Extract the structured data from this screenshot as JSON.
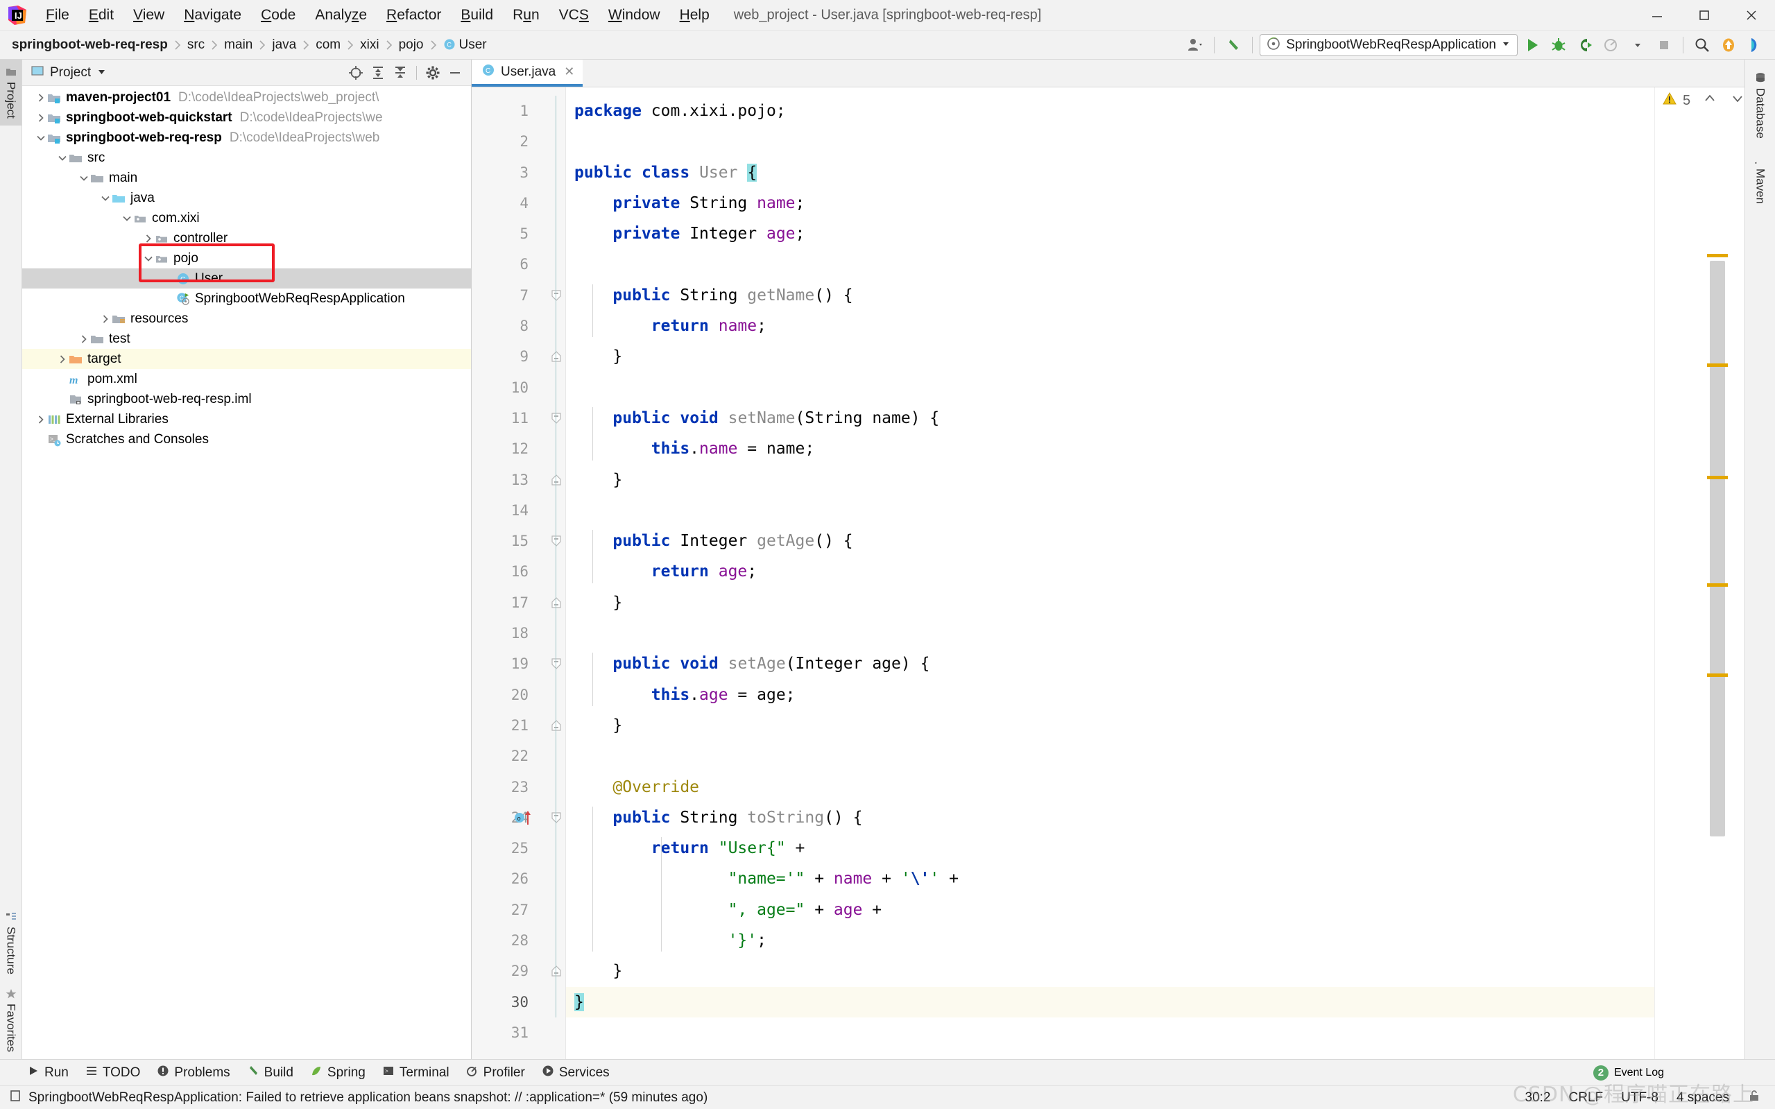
{
  "window": {
    "title": "web_project - User.java [springboot-web-req-resp]",
    "minimize_label": "minimize-window",
    "maximize_label": "maximize-window",
    "close_label": "close-window"
  },
  "menubar": [
    {
      "label": "File",
      "mnemonic": "F"
    },
    {
      "label": "Edit",
      "mnemonic": "E"
    },
    {
      "label": "View",
      "mnemonic": "V"
    },
    {
      "label": "Navigate",
      "mnemonic": "N"
    },
    {
      "label": "Code",
      "mnemonic": "C"
    },
    {
      "label": "Analyze",
      "mnemonic": "z"
    },
    {
      "label": "Refactor",
      "mnemonic": "R"
    },
    {
      "label": "Build",
      "mnemonic": "B"
    },
    {
      "label": "Run",
      "mnemonic": "u"
    },
    {
      "label": "VCS",
      "mnemonic": "S"
    },
    {
      "label": "Window",
      "mnemonic": "W"
    },
    {
      "label": "Help",
      "mnemonic": "H"
    }
  ],
  "breadcrumb": [
    {
      "label": "springboot-web-req-resp",
      "bold": true,
      "icon": ""
    },
    {
      "label": "src",
      "bold": false,
      "icon": ""
    },
    {
      "label": "main",
      "bold": false,
      "icon": ""
    },
    {
      "label": "java",
      "bold": false,
      "icon": ""
    },
    {
      "label": "com",
      "bold": false,
      "icon": ""
    },
    {
      "label": "xixi",
      "bold": false,
      "icon": ""
    },
    {
      "label": "pojo",
      "bold": false,
      "icon": ""
    },
    {
      "label": "User",
      "bold": false,
      "icon": "class-icon"
    }
  ],
  "toolbar": {
    "user_icon": "user-settings-icon",
    "back_icon": "back-arrow-icon",
    "run_config": "SpringbootWebReqRespApplication",
    "run_config_icon": "spring-boot-icon",
    "dropdown_icon": "chevron-down-icon",
    "buttons": [
      {
        "name": "run-button",
        "icon": "play-icon"
      },
      {
        "name": "debug-button",
        "icon": "bug-icon"
      },
      {
        "name": "run-with-coverage-button",
        "icon": "coverage-icon"
      },
      {
        "name": "profile-button",
        "icon": "profiler-icon"
      },
      {
        "name": "stop-button",
        "icon": "stop-icon"
      },
      {
        "name": "search-everywhere-button",
        "icon": "search-icon"
      },
      {
        "name": "update-project-button",
        "icon": "update-icon"
      },
      {
        "name": "ide-assistant-button",
        "icon": "assistant-icon"
      }
    ]
  },
  "left_rail": [
    {
      "label": "Project",
      "icon": "project-icon",
      "active": true
    },
    {
      "label": "Structure",
      "icon": "structure-icon",
      "active": false
    },
    {
      "label": "Favorites",
      "icon": "star-icon",
      "active": false
    }
  ],
  "right_rail": [
    {
      "label": "Database",
      "icon": "database-icon"
    },
    {
      "label": "Maven",
      "icon": "maven-icon"
    }
  ],
  "project_panel": {
    "title": "Project",
    "view_chevron": "chevron-down-icon",
    "tools": [
      {
        "name": "select-opened-file-button",
        "icon": "target-icon"
      },
      {
        "name": "expand-all-button",
        "icon": "expand-all-icon"
      },
      {
        "name": "collapse-all-button",
        "icon": "collapse-all-icon"
      },
      {
        "name": "settings-button",
        "icon": "gear-icon"
      },
      {
        "name": "hide-button",
        "icon": "minus-icon"
      }
    ],
    "tree": [
      {
        "label": "maven-project01",
        "path": "D:\\code\\IdeaProjects\\web_project\\",
        "depth": 0,
        "arrow": "right",
        "icon": "module-icon",
        "bold": true,
        "selected": false,
        "highlight": false
      },
      {
        "label": "springboot-web-quickstart",
        "path": "D:\\code\\IdeaProjects\\we",
        "depth": 0,
        "arrow": "right",
        "icon": "module-icon",
        "bold": true,
        "selected": false,
        "highlight": false
      },
      {
        "label": "springboot-web-req-resp",
        "path": "D:\\code\\IdeaProjects\\web",
        "depth": 0,
        "arrow": "down",
        "icon": "module-icon",
        "bold": true,
        "selected": false,
        "highlight": false
      },
      {
        "label": "src",
        "path": "",
        "depth": 1,
        "arrow": "down",
        "icon": "folder-icon",
        "bold": false,
        "selected": false,
        "highlight": false
      },
      {
        "label": "main",
        "path": "",
        "depth": 2,
        "arrow": "down",
        "icon": "folder-icon",
        "bold": false,
        "selected": false,
        "highlight": false
      },
      {
        "label": "java",
        "path": "",
        "depth": 3,
        "arrow": "down",
        "icon": "source-folder-icon",
        "bold": false,
        "selected": false,
        "highlight": false
      },
      {
        "label": "com.xixi",
        "path": "",
        "depth": 4,
        "arrow": "down",
        "icon": "package-icon",
        "bold": false,
        "selected": false,
        "highlight": false
      },
      {
        "label": "controller",
        "path": "",
        "depth": 5,
        "arrow": "right",
        "icon": "package-icon",
        "bold": false,
        "selected": false,
        "highlight": false
      },
      {
        "label": "pojo",
        "path": "",
        "depth": 5,
        "arrow": "down",
        "icon": "package-icon",
        "bold": false,
        "selected": false,
        "highlight": false
      },
      {
        "label": "User",
        "path": "",
        "depth": 6,
        "arrow": "none",
        "icon": "class-icon",
        "bold": false,
        "selected": true,
        "highlight": false
      },
      {
        "label": "SpringbootWebReqRespApplication",
        "path": "",
        "depth": 6,
        "arrow": "none",
        "icon": "spring-class-icon",
        "bold": false,
        "selected": false,
        "highlight": false
      },
      {
        "label": "resources",
        "path": "",
        "depth": 3,
        "arrow": "right",
        "icon": "resources-folder-icon",
        "bold": false,
        "selected": false,
        "highlight": false
      },
      {
        "label": "test",
        "path": "",
        "depth": 2,
        "arrow": "right",
        "icon": "folder-icon",
        "bold": false,
        "selected": false,
        "highlight": false
      },
      {
        "label": "target",
        "path": "",
        "depth": 1,
        "arrow": "right",
        "icon": "excluded-folder-icon",
        "bold": false,
        "selected": false,
        "highlight": true
      },
      {
        "label": "pom.xml",
        "path": "",
        "depth": 1,
        "arrow": "none",
        "icon": "maven-file-icon",
        "bold": false,
        "selected": false,
        "highlight": false
      },
      {
        "label": "springboot-web-req-resp.iml",
        "path": "",
        "depth": 1,
        "arrow": "none",
        "icon": "iml-file-icon",
        "bold": false,
        "selected": false,
        "highlight": false
      },
      {
        "label": "External Libraries",
        "path": "",
        "depth": 0,
        "arrow": "right",
        "icon": "libraries-icon",
        "bold": false,
        "selected": false,
        "highlight": false
      },
      {
        "label": "Scratches and Consoles",
        "path": "",
        "depth": 0,
        "arrow": "none",
        "icon": "scratches-icon",
        "bold": false,
        "selected": false,
        "highlight": false
      }
    ]
  },
  "editor": {
    "tabs": [
      {
        "label": "User.java",
        "icon": "class-icon",
        "active": true,
        "close_icon": "close-icon"
      }
    ],
    "inspection": {
      "warning_icon": "warning-triangle-icon",
      "warning_count": "5",
      "prev_icon": "chevron-up-icon",
      "next_icon": "chevron-down-icon"
    },
    "lines": [
      {
        "n": "1",
        "tokens": [
          [
            "kw",
            "package"
          ],
          [
            "plain",
            " "
          ],
          [
            "plain",
            "com.xixi.pojo;"
          ]
        ]
      },
      {
        "n": "2",
        "tokens": []
      },
      {
        "n": "3",
        "tokens": [
          [
            "kw",
            "public"
          ],
          [
            "plain",
            " "
          ],
          [
            "kw",
            "class"
          ],
          [
            "plain",
            " "
          ],
          [
            "cls2",
            "User"
          ],
          [
            "plain",
            " "
          ],
          [
            "brace-hl",
            "{"
          ]
        ]
      },
      {
        "n": "4",
        "tokens": [
          [
            "plain",
            "    "
          ],
          [
            "kw",
            "private"
          ],
          [
            "plain",
            " "
          ],
          [
            "cls",
            "String"
          ],
          [
            "plain",
            " "
          ],
          [
            "fld",
            "name"
          ],
          [
            "plain",
            ";"
          ]
        ]
      },
      {
        "n": "5",
        "tokens": [
          [
            "plain",
            "    "
          ],
          [
            "kw",
            "private"
          ],
          [
            "plain",
            " "
          ],
          [
            "cls",
            "Integer"
          ],
          [
            "plain",
            " "
          ],
          [
            "fld",
            "age"
          ],
          [
            "plain",
            ";"
          ]
        ]
      },
      {
        "n": "6",
        "tokens": []
      },
      {
        "n": "7",
        "tokens": [
          [
            "plain",
            "    "
          ],
          [
            "kw",
            "public"
          ],
          [
            "plain",
            " "
          ],
          [
            "cls",
            "String"
          ],
          [
            "plain",
            " "
          ],
          [
            "mth",
            "getName"
          ],
          [
            "plain",
            "() {"
          ]
        ]
      },
      {
        "n": "8",
        "tokens": [
          [
            "plain",
            "        "
          ],
          [
            "kw",
            "return"
          ],
          [
            "plain",
            " "
          ],
          [
            "fld",
            "name"
          ],
          [
            "plain",
            ";"
          ]
        ]
      },
      {
        "n": "9",
        "tokens": [
          [
            "plain",
            "    }"
          ]
        ]
      },
      {
        "n": "10",
        "tokens": []
      },
      {
        "n": "11",
        "tokens": [
          [
            "plain",
            "    "
          ],
          [
            "kw",
            "public"
          ],
          [
            "plain",
            " "
          ],
          [
            "kw",
            "void"
          ],
          [
            "plain",
            " "
          ],
          [
            "mth",
            "setName"
          ],
          [
            "plain",
            "("
          ],
          [
            "cls",
            "String"
          ],
          [
            "plain",
            " name) {"
          ]
        ]
      },
      {
        "n": "12",
        "tokens": [
          [
            "plain",
            "        "
          ],
          [
            "kw",
            "this"
          ],
          [
            "plain",
            "."
          ],
          [
            "fld",
            "name"
          ],
          [
            "plain",
            " = name;"
          ]
        ]
      },
      {
        "n": "13",
        "tokens": [
          [
            "plain",
            "    }"
          ]
        ]
      },
      {
        "n": "14",
        "tokens": []
      },
      {
        "n": "15",
        "tokens": [
          [
            "plain",
            "    "
          ],
          [
            "kw",
            "public"
          ],
          [
            "plain",
            " "
          ],
          [
            "cls",
            "Integer"
          ],
          [
            "plain",
            " "
          ],
          [
            "mth",
            "getAge"
          ],
          [
            "plain",
            "() {"
          ]
        ]
      },
      {
        "n": "16",
        "tokens": [
          [
            "plain",
            "        "
          ],
          [
            "kw",
            "return"
          ],
          [
            "plain",
            " "
          ],
          [
            "fld",
            "age"
          ],
          [
            "plain",
            ";"
          ]
        ]
      },
      {
        "n": "17",
        "tokens": [
          [
            "plain",
            "    }"
          ]
        ]
      },
      {
        "n": "18",
        "tokens": []
      },
      {
        "n": "19",
        "tokens": [
          [
            "plain",
            "    "
          ],
          [
            "kw",
            "public"
          ],
          [
            "plain",
            " "
          ],
          [
            "kw",
            "void"
          ],
          [
            "plain",
            " "
          ],
          [
            "mth",
            "setAge"
          ],
          [
            "plain",
            "("
          ],
          [
            "cls",
            "Integer"
          ],
          [
            "plain",
            " age) {"
          ]
        ]
      },
      {
        "n": "20",
        "tokens": [
          [
            "plain",
            "        "
          ],
          [
            "kw",
            "this"
          ],
          [
            "plain",
            "."
          ],
          [
            "fld",
            "age"
          ],
          [
            "plain",
            " = age;"
          ]
        ]
      },
      {
        "n": "21",
        "tokens": [
          [
            "plain",
            "    }"
          ]
        ]
      },
      {
        "n": "22",
        "tokens": []
      },
      {
        "n": "23",
        "tokens": [
          [
            "plain",
            "    "
          ],
          [
            "ann",
            "@Override"
          ]
        ]
      },
      {
        "n": "24",
        "tokens": [
          [
            "plain",
            "    "
          ],
          [
            "kw",
            "public"
          ],
          [
            "plain",
            " "
          ],
          [
            "cls",
            "String"
          ],
          [
            "plain",
            " "
          ],
          [
            "mth",
            "toString"
          ],
          [
            "plain",
            "() {"
          ]
        ]
      },
      {
        "n": "25",
        "tokens": [
          [
            "plain",
            "        "
          ],
          [
            "kw",
            "return"
          ],
          [
            "plain",
            " "
          ],
          [
            "str",
            "\"User{\""
          ],
          [
            "plain",
            " +"
          ]
        ]
      },
      {
        "n": "26",
        "tokens": [
          [
            "plain",
            "                "
          ],
          [
            "str",
            "\"name='\""
          ],
          [
            "plain",
            " + "
          ],
          [
            "fld",
            "name"
          ],
          [
            "plain",
            " + "
          ],
          [
            "str",
            "'"
          ],
          [
            "esc",
            "\\'"
          ],
          [
            "str",
            "'"
          ],
          [
            "plain",
            " +"
          ]
        ]
      },
      {
        "n": "27",
        "tokens": [
          [
            "plain",
            "                "
          ],
          [
            "str",
            "\", age=\""
          ],
          [
            "plain",
            " + "
          ],
          [
            "fld",
            "age"
          ],
          [
            "plain",
            " +"
          ]
        ]
      },
      {
        "n": "28",
        "tokens": [
          [
            "plain",
            "                "
          ],
          [
            "str",
            "'}'"
          ],
          [
            "plain",
            ";"
          ]
        ]
      },
      {
        "n": "29",
        "tokens": [
          [
            "plain",
            "    }"
          ]
        ]
      },
      {
        "n": "30",
        "tokens": [
          [
            "brace-hl",
            "}"
          ]
        ],
        "caret": true
      },
      {
        "n": "31",
        "tokens": []
      }
    ]
  },
  "bottom_tools": [
    {
      "label": "Run",
      "icon": "play-icon"
    },
    {
      "label": "TODO",
      "icon": "todo-icon"
    },
    {
      "label": "Problems",
      "icon": "problems-icon"
    },
    {
      "label": "Build",
      "icon": "build-hammer-icon"
    },
    {
      "label": "Spring",
      "icon": "spring-leaf-icon"
    },
    {
      "label": "Terminal",
      "icon": "terminal-icon"
    },
    {
      "label": "Profiler",
      "icon": "profiler-icon"
    },
    {
      "label": "Services",
      "icon": "services-icon"
    }
  ],
  "event_log": {
    "label": "Event Log",
    "count": "2",
    "icon": "event-log-icon"
  },
  "status": {
    "message_icon": "notification-icon",
    "message": "SpringbootWebReqRespApplication: Failed to retrieve application beans snapshot: // :application=* (59 minutes ago)",
    "caret_position": "30:2",
    "line_separator": "CRLF",
    "encoding": "UTF-8",
    "indent": "4 spaces",
    "lock_icon": "unlocked-icon"
  },
  "watermark": "CSDN @程序喵正在路上"
}
